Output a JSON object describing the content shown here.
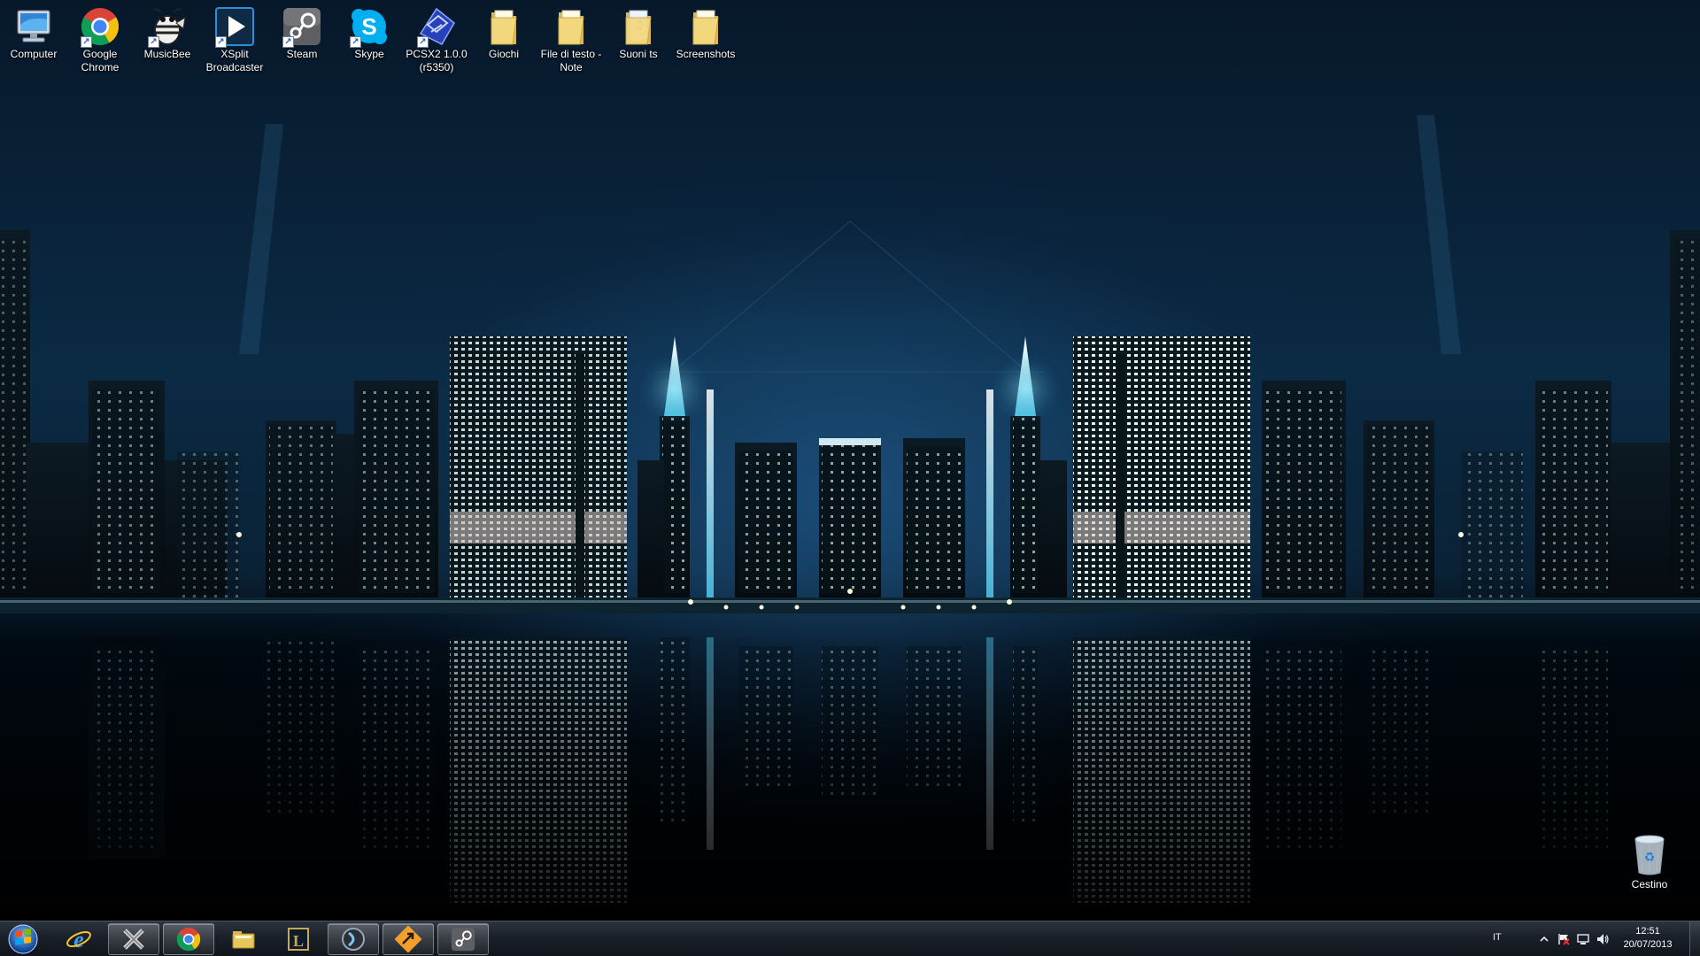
{
  "desktop": {
    "icons": [
      {
        "label": "Computer",
        "icon": "computer-icon",
        "shortcut": false
      },
      {
        "label": "Google Chrome",
        "icon": "chrome-icon",
        "shortcut": true
      },
      {
        "label": "MusicBee",
        "icon": "musicbee-icon",
        "shortcut": true
      },
      {
        "label": "XSplit Broadcaster",
        "icon": "xsplit-icon",
        "shortcut": true
      },
      {
        "label": "Steam",
        "icon": "steam-icon",
        "shortcut": true
      },
      {
        "label": "Skype",
        "icon": "skype-icon",
        "shortcut": true
      },
      {
        "label": "PCSX2 1.0.0 (r5350)",
        "icon": "pcsx2-icon",
        "shortcut": true
      },
      {
        "label": "Giochi",
        "icon": "folder-icon",
        "shortcut": false
      },
      {
        "label": "File di testo - Note",
        "icon": "folder-icon",
        "shortcut": false
      },
      {
        "label": "Suoni ts",
        "icon": "folder-music-icon",
        "shortcut": false
      },
      {
        "label": "Screenshots",
        "icon": "folder-icon",
        "shortcut": false
      }
    ],
    "recycle_bin": {
      "label": "Cestino",
      "icon": "recycle-bin-icon"
    }
  },
  "taskbar": {
    "start": {
      "icon": "windows-start-orb-icon"
    },
    "pinned": [
      {
        "name": "internet-explorer",
        "icon": "internet-explorer-icon",
        "active": false
      },
      {
        "name": "app-x",
        "icon": "x-app-icon",
        "active": true
      },
      {
        "name": "google-chrome",
        "icon": "chrome-icon",
        "active": true
      },
      {
        "name": "file-explorer",
        "icon": "folder-explorer-icon",
        "active": false
      },
      {
        "name": "league-of-legends",
        "icon": "league-of-legends-icon",
        "active": false
      },
      {
        "name": "media-app",
        "icon": "circle-media-icon",
        "active": true
      },
      {
        "name": "app-arrow",
        "icon": "arrow-app-icon",
        "active": true
      },
      {
        "name": "steam",
        "icon": "steam-icon",
        "active": true
      }
    ],
    "tray": {
      "language": "IT",
      "icons": [
        "show-hidden-icons-chevron-icon",
        "action-center-flag-icon",
        "network-icon",
        "volume-icon"
      ],
      "time": "12:51",
      "date": "20/07/2013"
    }
  },
  "colors": {
    "taskbar_bg": "#1a2029",
    "sky": "#0b2a44",
    "city_glow": "#7fe8ff"
  }
}
